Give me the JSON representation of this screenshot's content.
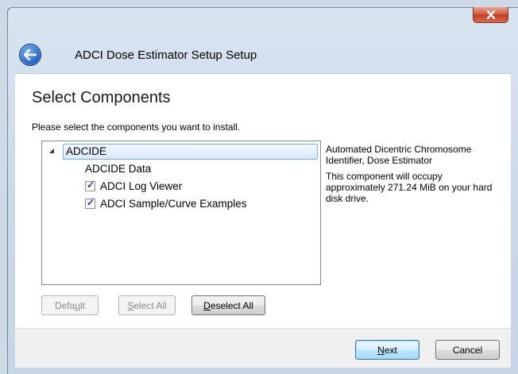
{
  "window": {
    "title": "ADCI Dose Estimator Setup Setup",
    "close_glyph": "x"
  },
  "header": {
    "heading": "Select Components",
    "instruction": "Please select the components you want to install."
  },
  "tree": {
    "root": {
      "label": "ADCIDE",
      "expanded": true
    },
    "items": [
      {
        "label": "ADCIDE Data",
        "checkbox": false
      },
      {
        "label": "ADCI Log Viewer",
        "checkbox": true,
        "checked": true
      },
      {
        "label": "ADCI Sample/Curve Examples",
        "checkbox": true,
        "checked": true
      }
    ]
  },
  "description": {
    "title": "Automated Dicentric Chromosome Identifier, Dose Estimator",
    "size_text": "This component will occupy approximately 271.24 MiB on your hard disk drive."
  },
  "buttons": {
    "default_pre": "Defa",
    "default_mn": "u",
    "default_post": "lt",
    "select_all_mn": "S",
    "select_all_post": "elect All",
    "deselect_all_mn": "D",
    "deselect_all_post": "eselect All",
    "next_mn": "N",
    "next_post": "ext",
    "cancel": "Cancel"
  },
  "colors": {
    "accent": "#3c7fb1",
    "check": "#27428c",
    "close": "#c23a1f"
  }
}
